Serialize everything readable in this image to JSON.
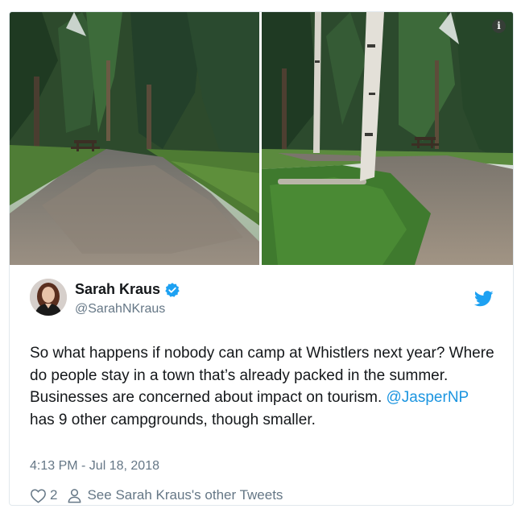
{
  "tweet": {
    "display_name": "Sarah Kraus",
    "handle": "@SarahNKraus",
    "text_before_mention": "So what happens if nobody can camp at Whistlers next year? Where do people stay in a town that’s already packed in the summer. Businesses are concerned about impact on tourism. ",
    "mention": "@JasperNP",
    "text_after_mention": " has 9 other campgrounds, though smaller.",
    "timestamp": "4:13 PM - Jul 18, 2018",
    "like_count": "2",
    "other_tweets_link": "See Sarah Kraus's other Tweets"
  },
  "media": {
    "info_icon": "i",
    "photos": [
      {
        "name": "campsite-photo-left",
        "content": "gravel path through forest with picnic table"
      },
      {
        "name": "campsite-photo-right",
        "content": "gravel path with birch tree and grass"
      }
    ]
  },
  "icons": {
    "verified": "verified-badge-icon",
    "twitter": "twitter-bird-icon",
    "like": "heart-icon",
    "profile": "person-icon",
    "info": "info-icon"
  },
  "colors": {
    "link": "#1b95e0",
    "text": "#14171a",
    "muted": "#657786",
    "border": "#e1e8ed",
    "verified": "#1da1f2"
  }
}
